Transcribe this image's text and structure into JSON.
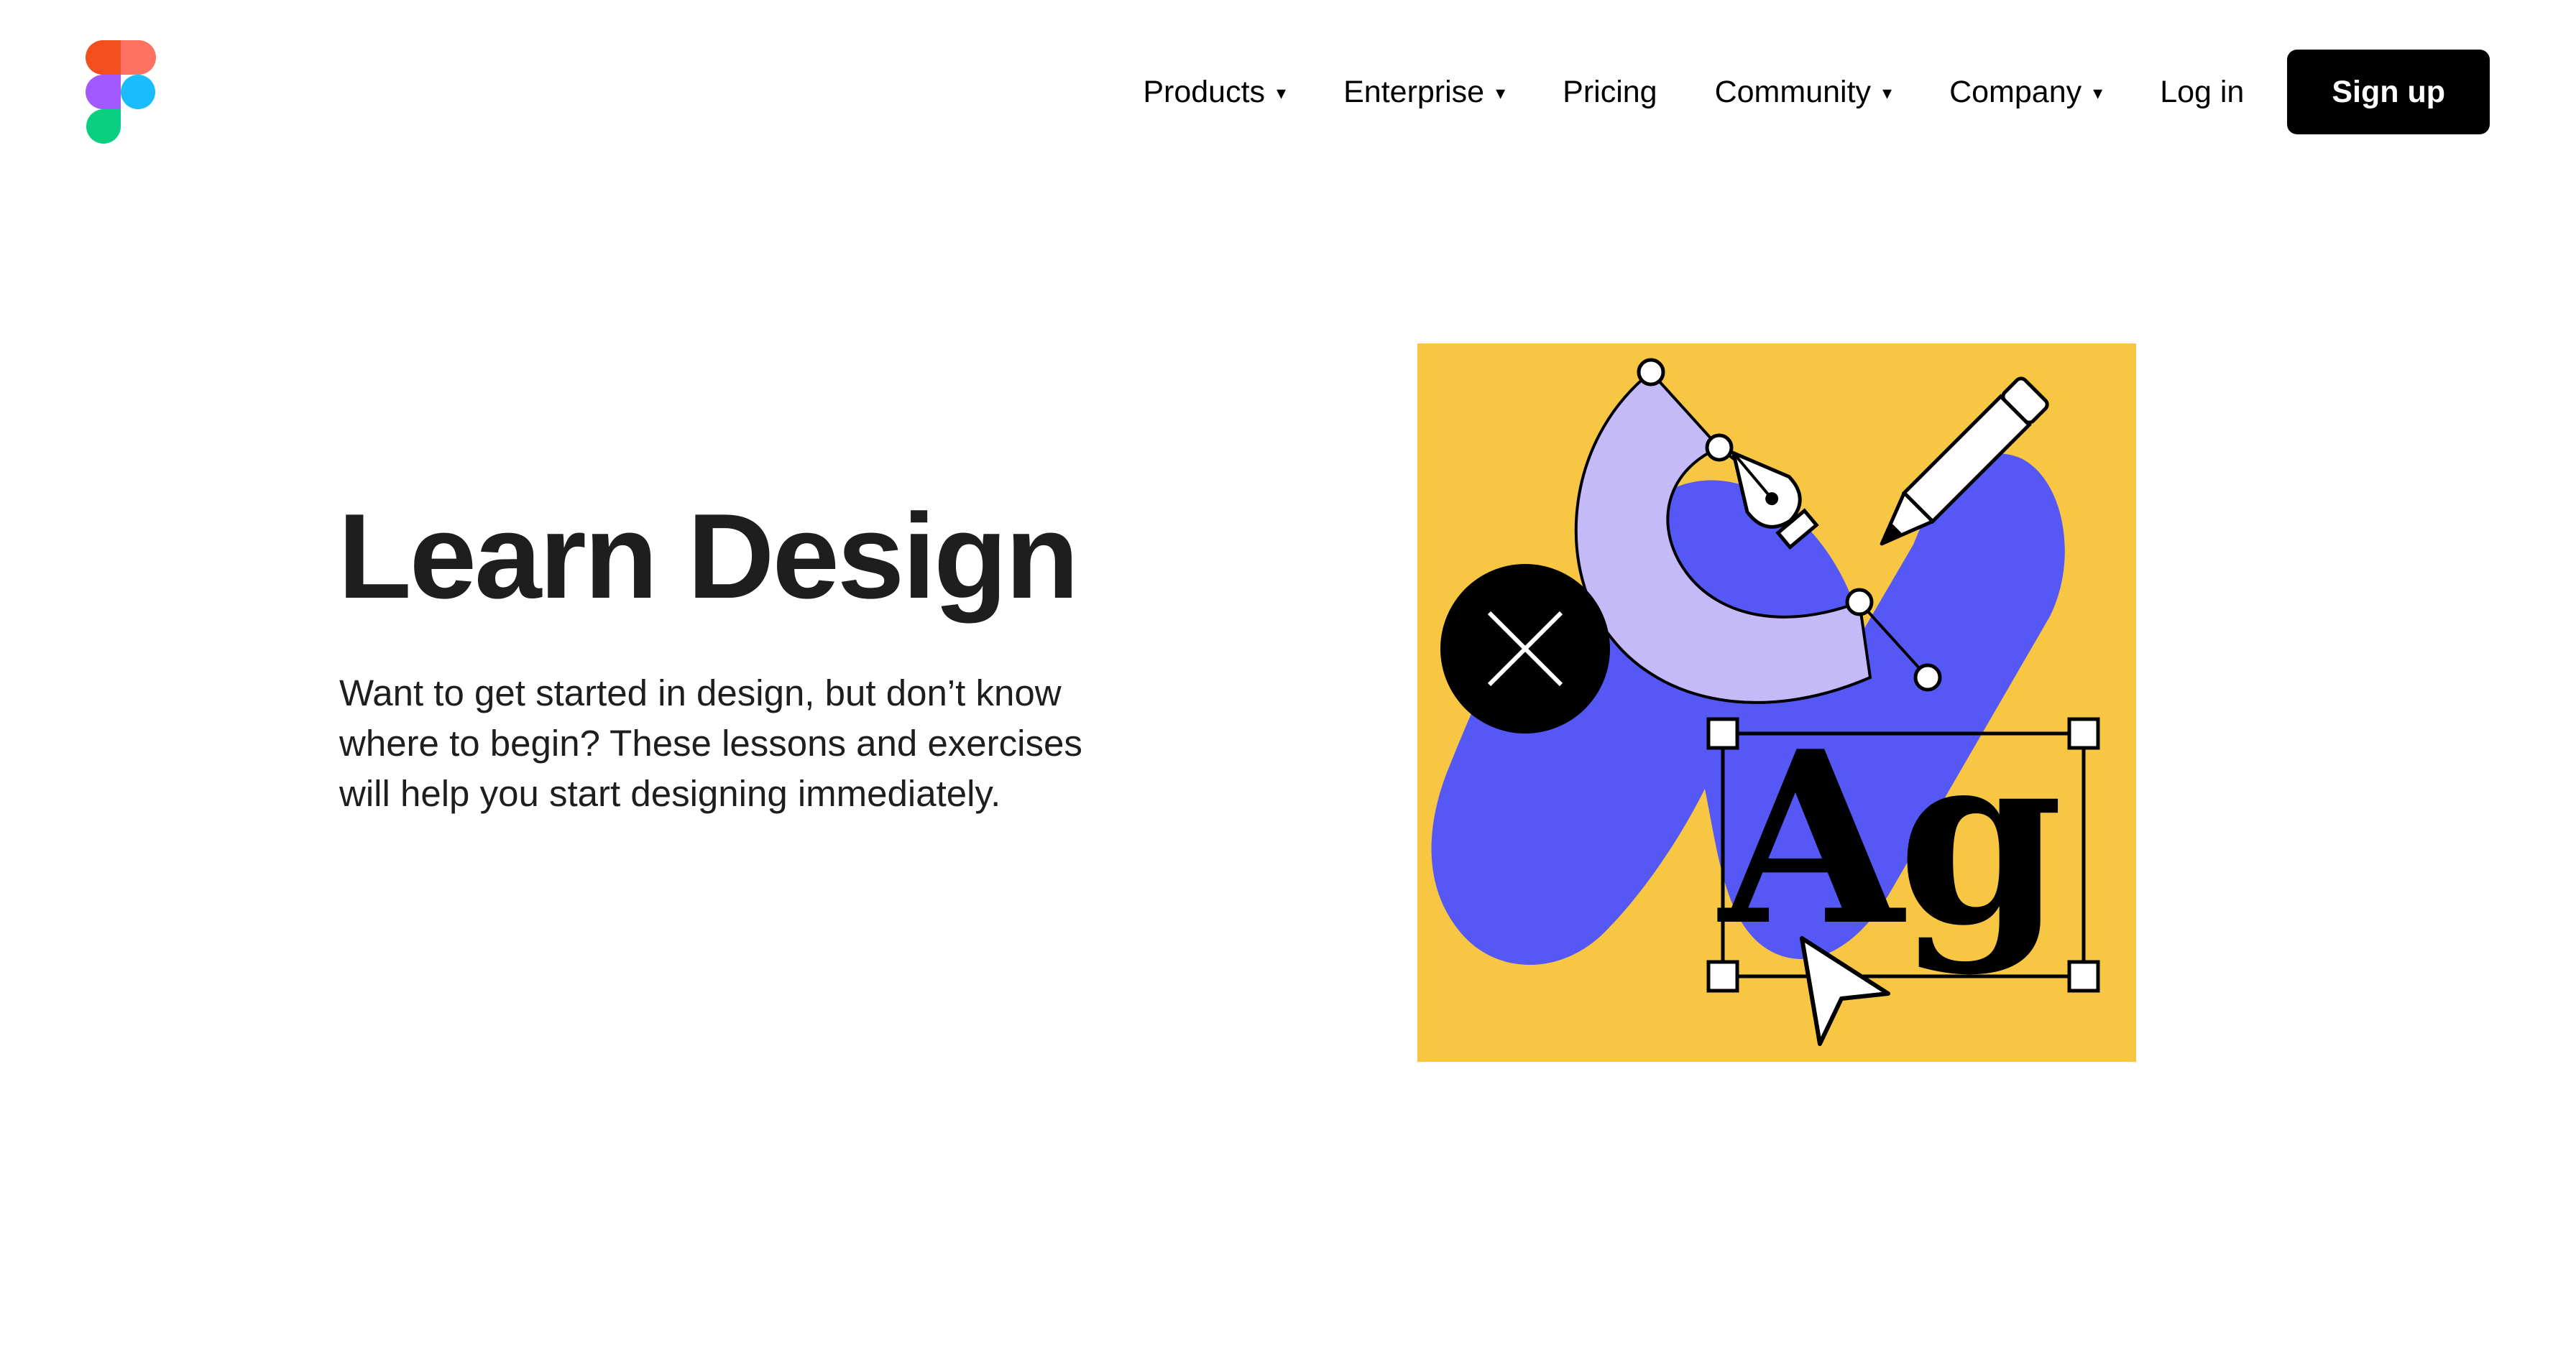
{
  "brand": {
    "logo_icon": "figma-logo-icon",
    "colors": [
      "#F24E1E",
      "#FF7262",
      "#A259FF",
      "#1ABCFE",
      "#0ACF83"
    ]
  },
  "nav": {
    "products": "Products",
    "enterprise": "Enterprise",
    "pricing": "Pricing",
    "community": "Community",
    "company": "Company",
    "login": "Log in",
    "signup": "Sign up",
    "dropdown_icon": "caret-down-icon",
    "caret_glyph": "▾"
  },
  "hero": {
    "title": "Learn Design",
    "description": "Want to get started in design, but don’t know where to begin? These lessons and exercises will help you start designing immediately."
  },
  "illustration": {
    "text": "Ag",
    "icons": [
      "pen-tool-icon",
      "pencil-icon",
      "close-icon",
      "cursor-arrow-icon"
    ],
    "colors": {
      "background": "#F7C744",
      "blue": "#5558F5",
      "lavender": "#C4BAF8",
      "ink": "#000000"
    }
  }
}
